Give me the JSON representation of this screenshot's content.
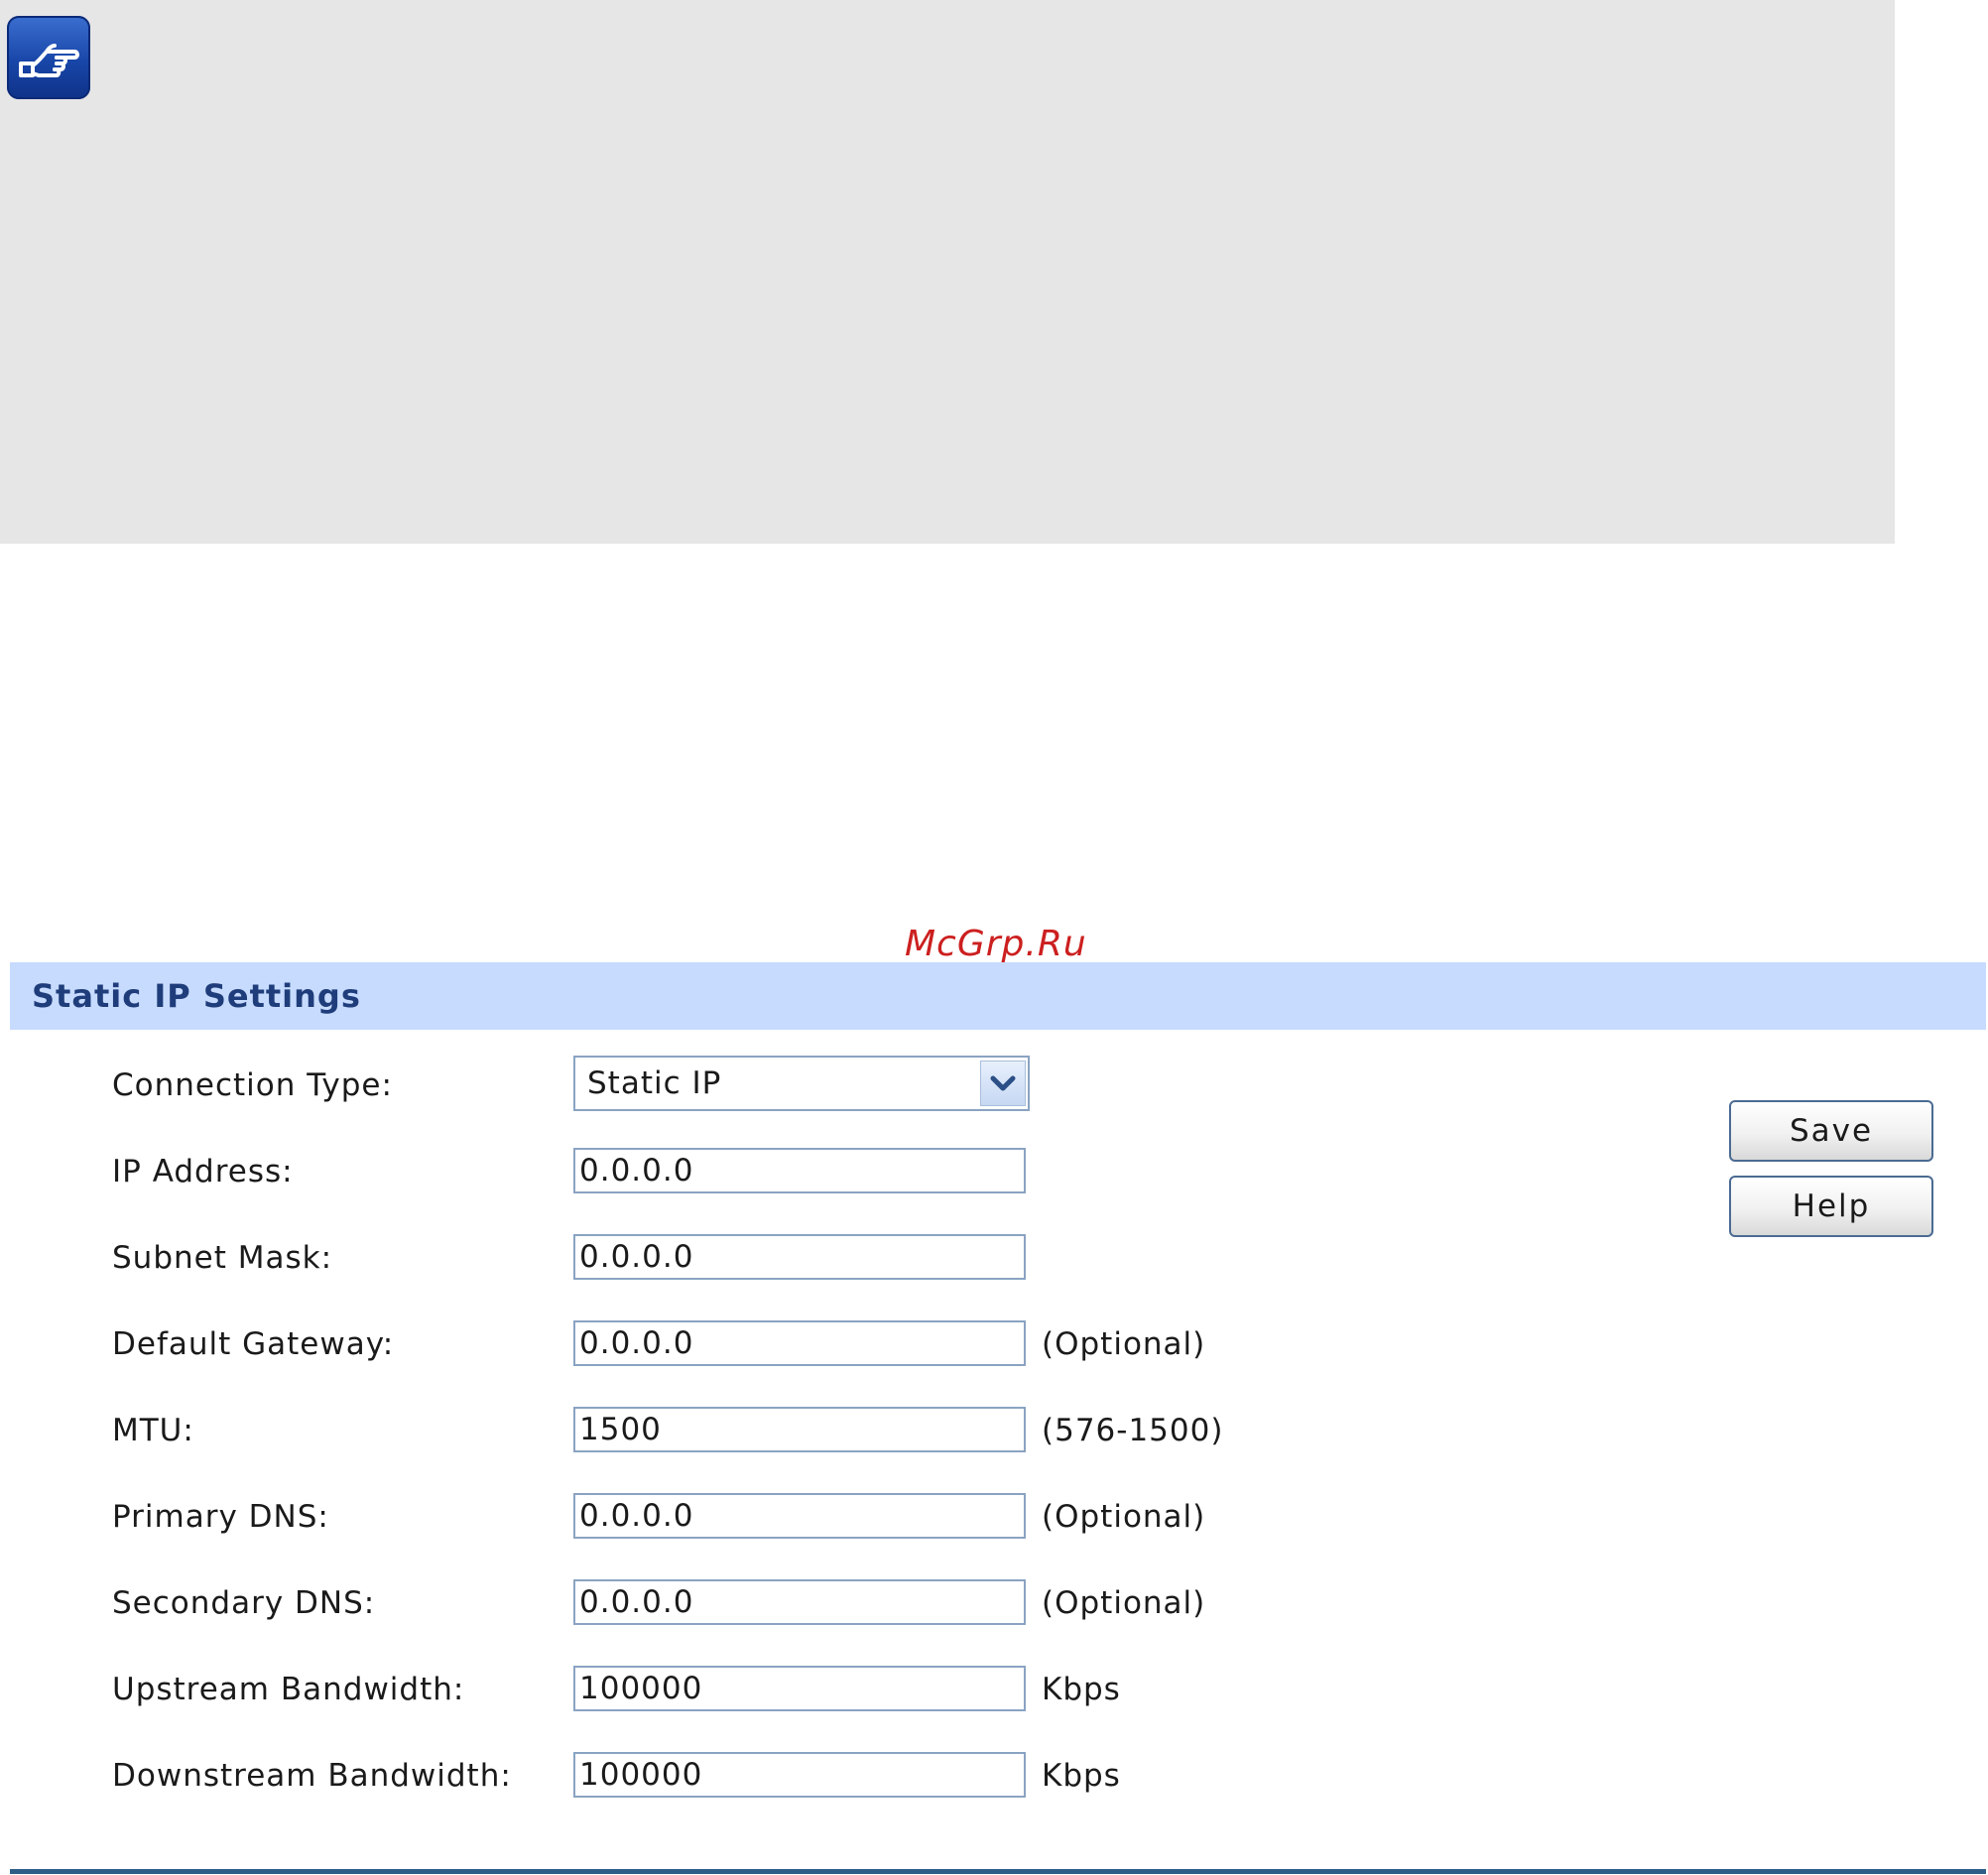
{
  "note": {
    "icon": "pointing-hand-icon"
  },
  "watermark": "McGrp.Ru",
  "panel": {
    "title": "Static IP Settings",
    "fields": [
      {
        "label": "Connection Type:",
        "value": "Static IP",
        "type": "select"
      },
      {
        "label": "IP Address:",
        "value": "0.0.0.0",
        "hint": ""
      },
      {
        "label": "Subnet Mask:",
        "value": "0.0.0.0",
        "hint": ""
      },
      {
        "label": "Default Gateway:",
        "value": "0.0.0.0",
        "hint": "(Optional)"
      },
      {
        "label": "MTU:",
        "value": "1500",
        "hint": "(576-1500)"
      },
      {
        "label": "Primary DNS:",
        "value": "0.0.0.0",
        "hint": "(Optional)"
      },
      {
        "label": "Secondary DNS:",
        "value": "0.0.0.0",
        "hint": "(Optional)"
      },
      {
        "label": "Upstream Bandwidth:",
        "value": "100000",
        "hint": "Kbps"
      },
      {
        "label": "Downstream Bandwidth:",
        "value": "100000",
        "hint": "Kbps"
      }
    ],
    "buttons": {
      "save": "Save",
      "help": "Help"
    }
  },
  "colors": {
    "header_bg": "#c7dbff",
    "header_text": "#1f3d7a",
    "watermark": "#cc1f1f",
    "note_bg": "#e6e6e6"
  }
}
